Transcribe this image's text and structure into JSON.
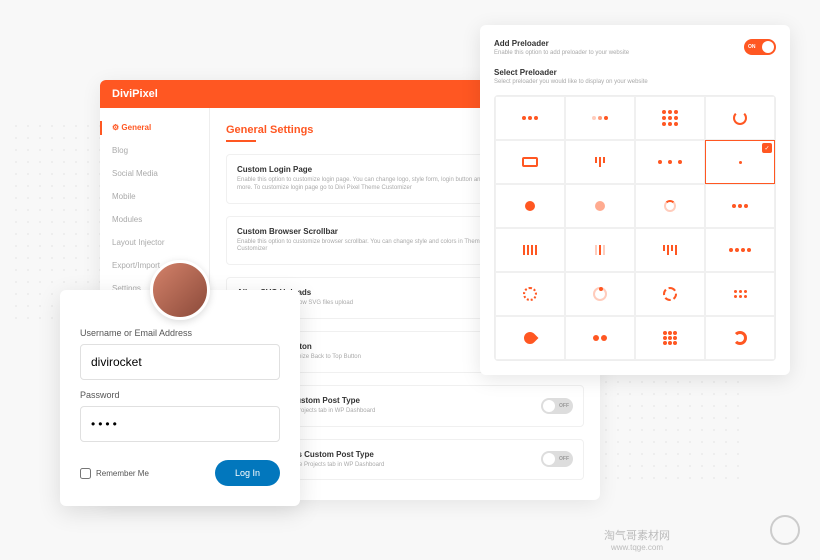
{
  "brand": "DiviPixel",
  "nav": {
    "items": [
      "General",
      "Blog",
      "Social Media",
      "Mobile",
      "Modules",
      "Layout Injector",
      "Export/Import",
      "Settings"
    ],
    "active": 0
  },
  "section_title": "General Settings",
  "settings": [
    {
      "title": "Custom Login Page",
      "desc": "Enable this option to customize login page. You can change logo, style form, login button and more. To customize login page go to Divi Pixel Theme Customizer",
      "on": true
    },
    {
      "title": "Custom Browser Scrollbar",
      "desc": "Enable this option to customize browser scrollbar. You can change style and colors in Theme Customizer",
      "on": false
    },
    {
      "title": "Allow SVG Uploads",
      "desc": "Enable this option to allow SVG files upload",
      "on": true
    },
    {
      "title": "Back To Top Button",
      "desc": "Enable option to customize Back to Top Button",
      "on": false
    },
    {
      "title": "Hide Projects Custom Post Type",
      "desc": "Enable option to hide Projects tab in WP Dashboard",
      "on": false
    },
    {
      "title": "Rename Projects Custom Post Type",
      "desc": "Enable option to rename Projects tab in WP Dashboard",
      "on": false
    }
  ],
  "toggle_labels": {
    "on": "ON",
    "off": "OFF"
  },
  "preloader": {
    "add_title": "Add Preloader",
    "add_desc": "Enable this option to add preloader to your website",
    "add_on": true,
    "select_title": "Select Preloader",
    "select_desc": "Select preloader you would like to display on your website",
    "selected_index": 7
  },
  "login": {
    "username_label": "Username or Email Address",
    "username_value": "divirocket",
    "password_label": "Password",
    "password_value": "••••",
    "remember_label": "Remember Me",
    "button": "Log In"
  },
  "watermark": {
    "main": "淘气哥素材网",
    "sub": "www.tqge.com"
  }
}
